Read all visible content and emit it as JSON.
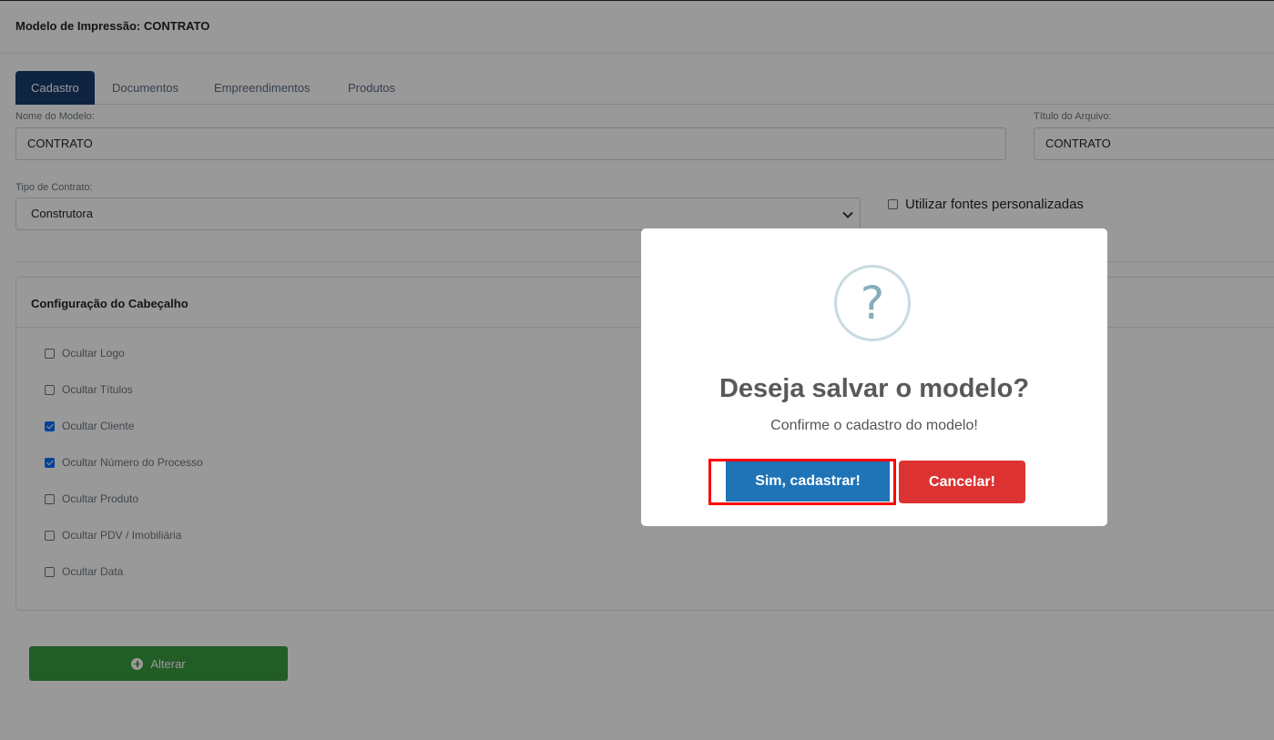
{
  "header": {
    "title": "Modelo de Impressão: CONTRATO"
  },
  "tabs": [
    {
      "label": "Cadastro",
      "active": true
    },
    {
      "label": "Documentos",
      "active": false
    },
    {
      "label": "Empreendimentos",
      "active": false
    },
    {
      "label": "Produtos",
      "active": false
    }
  ],
  "form": {
    "nome_modelo": {
      "label": "Nome do Modelo:",
      "value": "CONTRATO"
    },
    "titulo_arquivo": {
      "label": "Título do Arquivo:",
      "value": "CONTRATO"
    },
    "tipo_contrato": {
      "label": "Tipo de Contrato:",
      "value": "Construtora"
    },
    "fontes_personalizadas": {
      "label": "Utilizar fontes personalizadas",
      "checked": false
    }
  },
  "cabecalho": {
    "title": "Configuração do Cabeçalho",
    "options": [
      {
        "label": "Ocultar Logo",
        "checked": false
      },
      {
        "label": "Ocultar Títulos",
        "checked": false
      },
      {
        "label": "Ocultar Cliente",
        "checked": true
      },
      {
        "label": "Ocultar Número do Processo",
        "checked": true
      },
      {
        "label": "Ocultar Produto",
        "checked": false
      },
      {
        "label": "Ocultar PDV / Imobiliária",
        "checked": false
      },
      {
        "label": "Ocultar Data",
        "checked": false
      }
    ]
  },
  "actions": {
    "alterar_label": "Alterar"
  },
  "modal": {
    "icon": "?",
    "title": "Deseja salvar o modelo?",
    "text": "Confirme o cadastro do modelo!",
    "confirm_label": "Sim, cadastrar!",
    "cancel_label": "Cancelar!"
  },
  "colors": {
    "tab_active": "#1a3d6d",
    "alterar_button": "#3a9b40",
    "confirm_button": "#1f73b7",
    "cancel_button": "#dc3232",
    "highlight": "#ff0000"
  }
}
